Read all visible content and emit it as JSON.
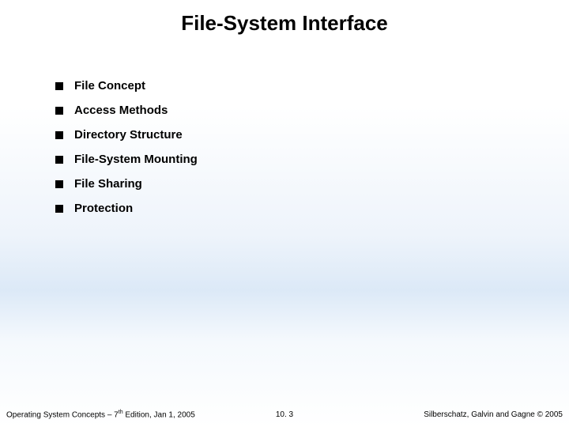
{
  "title": "File-System Interface",
  "bullets": [
    "File Concept",
    "Access Methods",
    "Directory Structure",
    "File-System Mounting",
    "File Sharing",
    "Protection"
  ],
  "footer": {
    "left_prefix": "Operating System Concepts – 7",
    "left_sup": "th",
    "left_suffix": " Edition, Jan 1, 2005",
    "center": "10. 3",
    "right": "Silberschatz, Galvin and Gagne © 2005"
  }
}
